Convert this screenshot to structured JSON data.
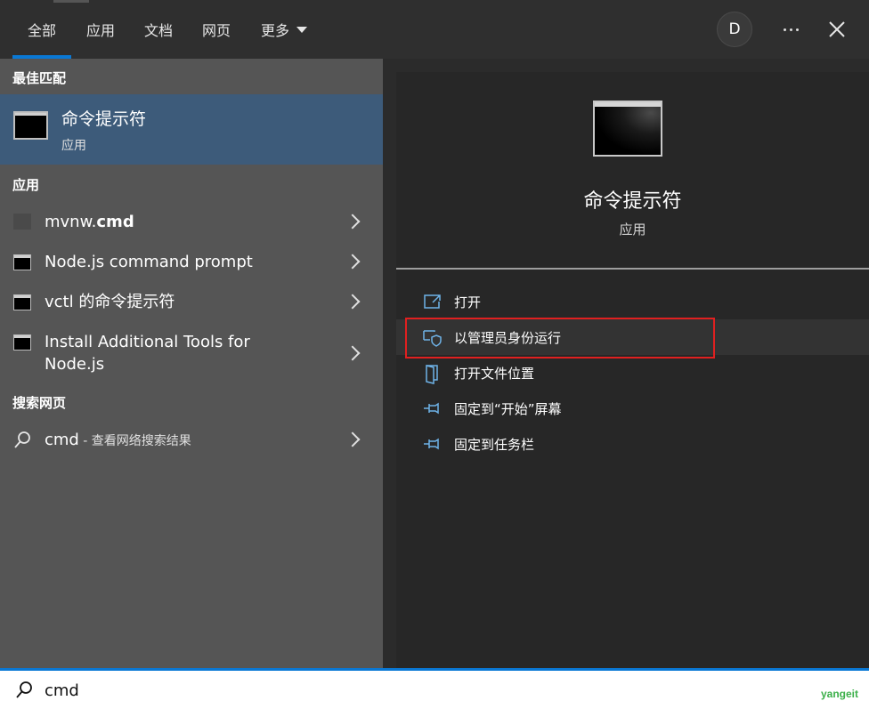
{
  "tabs": [
    {
      "label": "全部",
      "active": true
    },
    {
      "label": "应用",
      "active": false
    },
    {
      "label": "文档",
      "active": false
    },
    {
      "label": "网页",
      "active": false
    },
    {
      "label": "更多",
      "active": false
    }
  ],
  "header": {
    "avatar_letter": "D",
    "more_icon": "ellipsis-icon",
    "close_icon": "close-icon"
  },
  "left": {
    "best_match_title": "最佳匹配",
    "best_match": {
      "name": "命令提示符",
      "type": "应用",
      "icon": "command-prompt-icon"
    },
    "apps_title": "应用",
    "apps": [
      {
        "name_prefix": "mvnw.",
        "name_bold": "cmd",
        "icon": "script-file-icon"
      },
      {
        "name": "Node.js command prompt",
        "icon": "command-prompt-icon"
      },
      {
        "name": "vctl 的命令提示符",
        "icon": "command-prompt-icon"
      },
      {
        "name_line1": "Install Additional Tools for",
        "name_line2": "Node.js",
        "icon": "command-prompt-icon"
      }
    ],
    "web_title": "搜索网页",
    "web": {
      "query": "cmd",
      "suffix": " - 查看网络搜索结果",
      "icon": "search-icon"
    }
  },
  "detail": {
    "name": "命令提示符",
    "type": "应用",
    "actions": [
      {
        "label": "打开",
        "icon": "open-icon"
      },
      {
        "label": "以管理员身份运行",
        "icon": "shield-icon",
        "highlighted": true
      },
      {
        "label": "打开文件位置",
        "icon": "folder-location-icon"
      },
      {
        "label": "固定到“开始”屏幕",
        "icon": "pin-icon"
      },
      {
        "label": "固定到任务栏",
        "icon": "pin-icon"
      }
    ]
  },
  "search": {
    "value": "cmd"
  },
  "watermark": "yangeit",
  "colors": {
    "accent": "#0a78d4",
    "selection": "#3d5b7a",
    "highlight_border": "#e02020"
  }
}
